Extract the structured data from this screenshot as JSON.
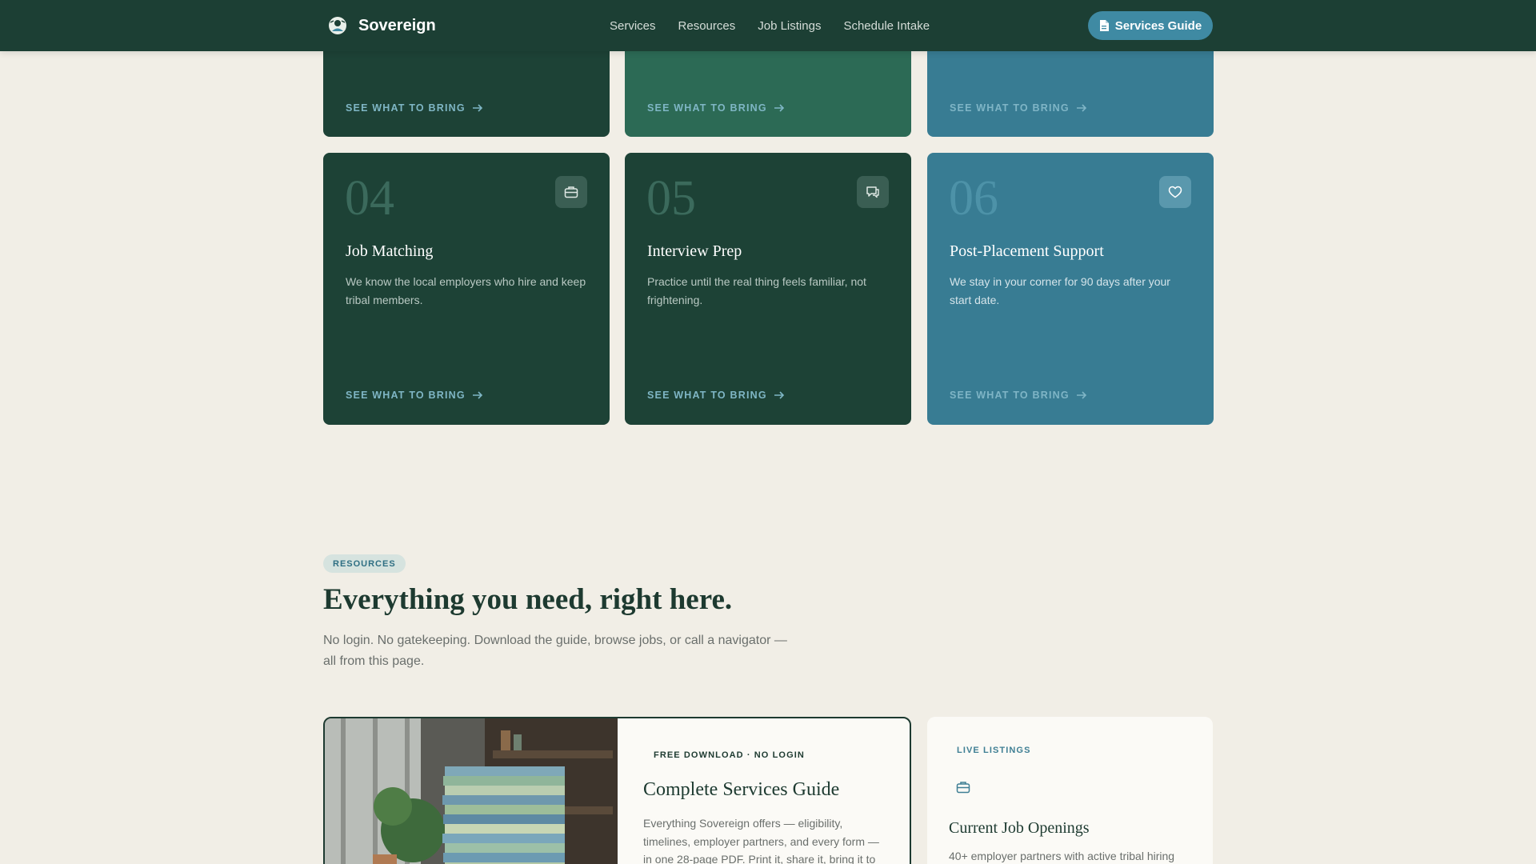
{
  "nav": {
    "brand": "Sovereign",
    "links": [
      "Services",
      "Resources",
      "Job Listings",
      "Schedule Intake"
    ],
    "cta": "Services Guide"
  },
  "cards_top": [
    {
      "link": "SEE WHAT TO BRING"
    },
    {
      "link": "SEE WHAT TO BRING"
    },
    {
      "link": "SEE WHAT TO BRING"
    }
  ],
  "cards": [
    {
      "num": "04",
      "icon": "briefcase-icon",
      "title": "Job Matching",
      "desc": "We know the local employers who hire and keep tribal members.",
      "link": "SEE WHAT TO BRING"
    },
    {
      "num": "05",
      "icon": "chat-icon",
      "title": "Interview Prep",
      "desc": "Practice until the real thing feels familiar, not frightening.",
      "link": "SEE WHAT TO BRING"
    },
    {
      "num": "06",
      "icon": "heart-icon",
      "title": "Post-Placement Support",
      "desc": "We stay in your corner for 90 days after your start date.",
      "link": "SEE WHAT TO BRING"
    }
  ],
  "resources": {
    "badge": "RESOURCES",
    "title": "Everything you need, right here.",
    "desc": "No login. No gatekeeping. Download the guide, browse jobs, or call a navigator — all from this page.",
    "guide": {
      "tag": "FREE DOWNLOAD · NO LOGIN",
      "title": "Complete Services Guide",
      "desc": "Everything Sovereign offers — eligibility, timelines, employer partners, and every form — in one 28-page PDF. Print it, share it, bring it to"
    },
    "jobs": {
      "tag": "LIVE LISTINGS",
      "title": "Current Job Openings",
      "desc": "40+ employer partners with active tribal hiring"
    }
  },
  "colors": {
    "nav_bg": "#1c3f34",
    "accent": "#3f8aa3",
    "card_dark": "#1d4236",
    "card_mid": "#2c6a55",
    "card_blue": "#387c93",
    "page_bg": "#f1eee6"
  }
}
